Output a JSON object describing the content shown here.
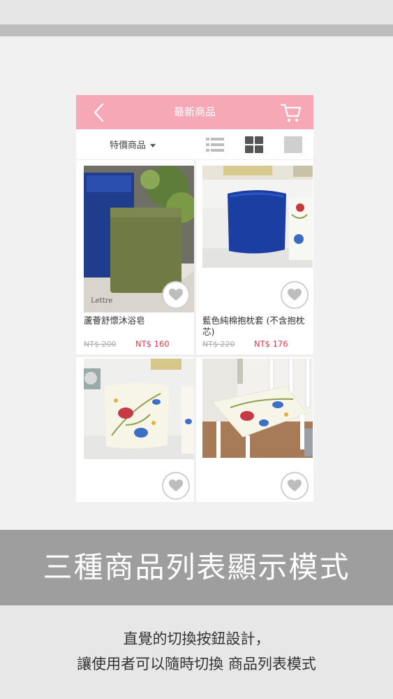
{
  "header": {
    "title": "最新商品"
  },
  "filter": {
    "selected": "特價商品"
  },
  "products": [
    {
      "name": "蘆薈舒懷沐浴皂",
      "old_price": "NT$ 200",
      "new_price": "NT$ 160"
    },
    {
      "name": "藍色純棉抱枕套 (不含抱枕芯)",
      "old_price": "NT$ 220",
      "new_price": "NT$ 176"
    },
    {
      "name": "",
      "old_price": "",
      "new_price": ""
    },
    {
      "name": "",
      "old_price": "",
      "new_price": ""
    }
  ],
  "caption": {
    "headline": "三種商品列表顯示模式",
    "line1": "直覺的切換按鈕設計，",
    "line2": "讓使用者可以隨時切換  商品列表模式"
  },
  "colors": {
    "header_pink": "#f6a8b6",
    "sale_price": "#e0334d",
    "caption_bar": "#9e9e9e"
  },
  "icons": [
    "back-icon",
    "cart-icon",
    "list-view-icon",
    "grid-view-icon",
    "single-view-icon",
    "heart-icon"
  ]
}
